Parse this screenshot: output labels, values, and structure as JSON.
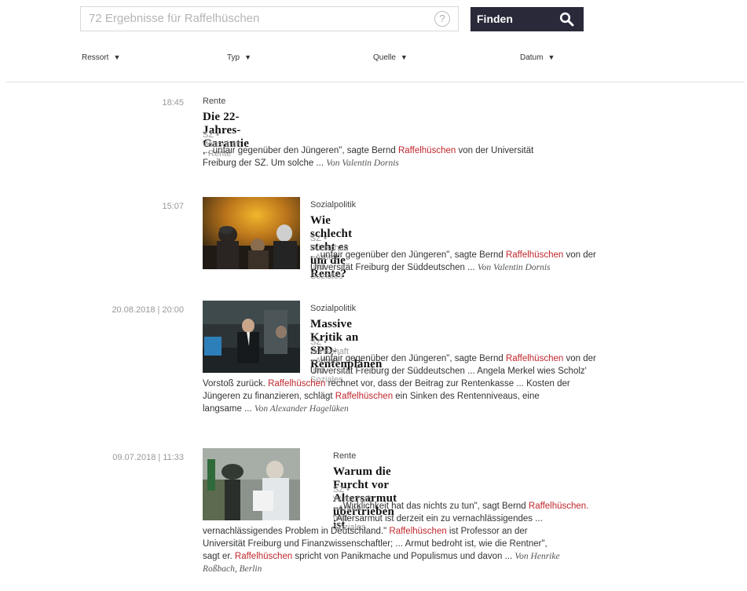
{
  "search": {
    "placeholder": "72 Ergebnisse für Raffelhüschen",
    "help_label": "?",
    "button_label": "Finden"
  },
  "filters": [
    {
      "label": "Ressort"
    },
    {
      "label": "Typ"
    },
    {
      "label": "Quelle"
    },
    {
      "label": "Datum"
    }
  ],
  "results": [
    {
      "time": "18:45",
      "category": "Rente",
      "title": "Die 22-Jahres-Garantie",
      "meta": "SZ • Wirtschaft • Rente",
      "snippet_1a": "... unfair gegenüber den Jüngeren\", sagte Bernd ",
      "hl_1": "Raffelhüschen",
      "snippet_1b": " von der Universität",
      "snippet_2a": "Freiburg der SZ. Um solche ... ",
      "author": "Von Valentin Dornis"
    },
    {
      "time": "15:07",
      "category": "Sozialpolitik",
      "title": "Wie schlecht steht es um die Rente?",
      "meta": "SZ • Wirtschaft • Arbeit und Soziales",
      "snippet_1a": "... unfair gegenüber den Jüngeren\", sagte Bernd ",
      "hl_1": "Raffelhüschen",
      "snippet_1b": " von der",
      "snippet_2a": "Universität Freiburg der Süddeutschen ... ",
      "author": "Von Valentin Dornis"
    },
    {
      "time": "20.08.2018 | 20:00",
      "category": "Sozialpolitik",
      "title": "Massive Kritik an SPD-Rentenplänen",
      "meta": "SZ • Wirtschaft • Arbeit und Soziales",
      "snippet_1a": "... unfair gegenüber den Jüngeren\", sagte Bernd ",
      "hl_1": "Raffelhüschen",
      "snippet_1b": " von der",
      "snippet_2a": "Universität Freiburg der Süddeutschen ... Angela Merkel wies Scholz'",
      "snippet_3a": "Vorstoß zurück. ",
      "hl_3": "Raffelhüschen",
      "snippet_3b": " rechnet vor, dass der Beitrag zur Rentenkasse ... Kosten der",
      "snippet_4a": "Jüngeren zu finanzieren, schlägt ",
      "hl_4": "Raffelhüschen",
      "snippet_4b": " ein Sinken des Rentenniveaus, eine",
      "snippet_5a": "langsame ... ",
      "author": "Von Alexander Hagelüken"
    },
    {
      "time": "09.07.2018 | 11:33",
      "category": "Rente",
      "title": "Warum die Furcht vor Altersarmut übertrieben ist",
      "meta": "SZ • Wirtschaft • Arbeit und Soziales",
      "snippet_1a": "... Wirklichkeit hat das nichts zu tun\", sagt Bernd ",
      "hl_1": "Raffelhüschen.",
      "snippet_2a": "\"Altersarmut ist derzeit ein zu vernachlässigendes ...",
      "snippet_3a": "vernachlässigendes Problem in Deutschland.\" ",
      "hl_3": "Raffelhüschen",
      "snippet_3b": " ist Professor an der",
      "snippet_4a": "Universität Freiburg und Finanzwissenschaftler; ... Armut bedroht ist, wie die Rentner\",",
      "snippet_5a": "sagt er. ",
      "hl_5": "Raffelhüschen",
      "snippet_5b": " spricht von Panikmache und Populismus und davon ... ",
      "author": "Von Henrike",
      "author_2": "Roßbach, Berlin"
    }
  ],
  "colors": {
    "highlight": "#c0262c",
    "button_bg": "#29293a"
  },
  "icons": {
    "search_button": "search-icon",
    "help": "help-icon",
    "filter_caret": "caret-down-icon"
  }
}
